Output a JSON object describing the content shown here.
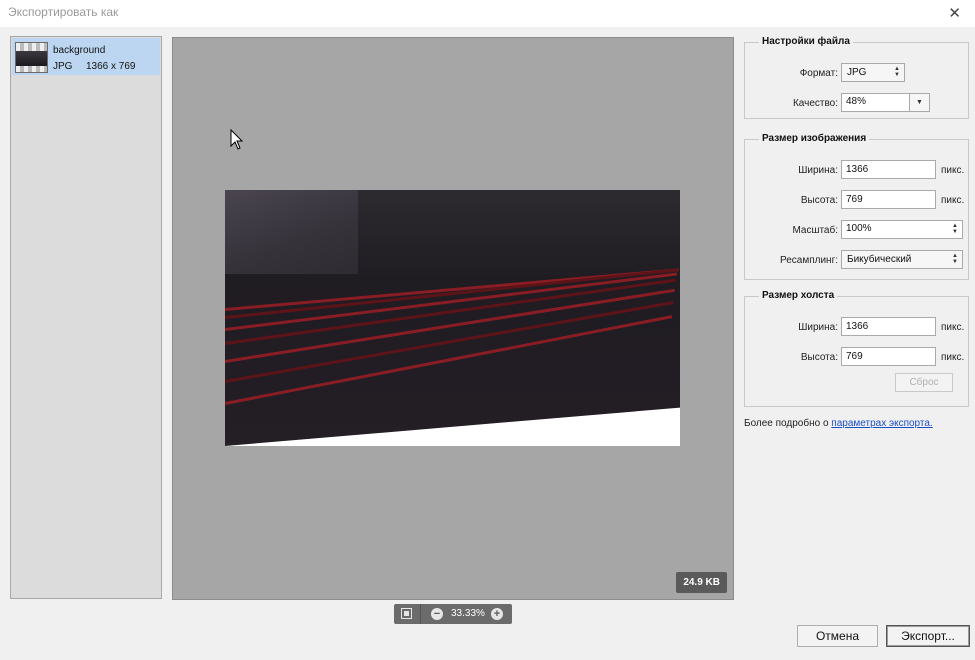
{
  "window": {
    "title": "Экспортировать как",
    "close_glyph": "✕"
  },
  "layers": [
    {
      "name": "background",
      "format": "JPG",
      "size": "1366 x 769"
    }
  ],
  "preview": {
    "file_size": "24.9 KB"
  },
  "zoom": {
    "value": "33.33%",
    "minus": "−",
    "plus": "+"
  },
  "file_settings": {
    "title": "Настройки файла",
    "format_label": "Формат:",
    "format_value": "JPG",
    "quality_label": "Качество:",
    "quality_value": "48%"
  },
  "image_size": {
    "title": "Размер изображения",
    "width_label": "Ширина:",
    "width_value": "1366",
    "height_label": "Высота:",
    "height_value": "769",
    "unit": "пикс.",
    "scale_label": "Масштаб:",
    "scale_value": "100%",
    "resample_label": "Ресамплинг:",
    "resample_value": "Бикубический"
  },
  "canvas_size": {
    "title": "Размер холста",
    "width_label": "Ширина:",
    "width_value": "1366",
    "height_label": "Высота:",
    "height_value": "769",
    "unit": "пикс.",
    "reset_label": "Сброс"
  },
  "help": {
    "text": "Более подробно о",
    "link": "параметрах экспорта."
  },
  "buttons": {
    "cancel": "Отмена",
    "export": "Экспорт..."
  },
  "colors": {
    "selection": "#bcd6f2",
    "preview_bg": "#a6a6a6",
    "link": "#1a4ec9",
    "seat_red": "#8a1c24"
  },
  "icons": [
    "close-icon",
    "fit-screen-icon",
    "zoom-out-icon",
    "zoom-in-icon",
    "mouse-pointer-icon"
  ]
}
